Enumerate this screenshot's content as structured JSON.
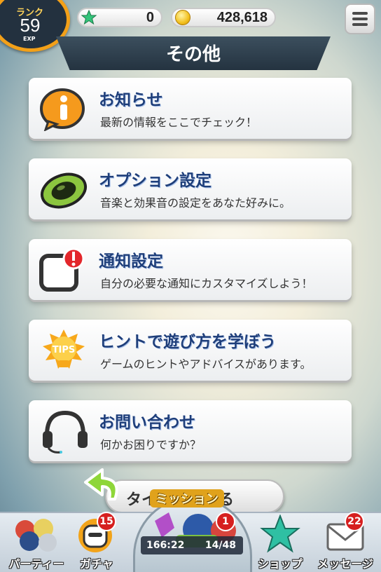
{
  "header": {
    "rank_label": "ランク",
    "rank_value": "59",
    "exp_label": "EXP",
    "stars": "0",
    "coins": "428,618",
    "star_icon": "green-star-icon",
    "coin_icon": "gold-coin-icon"
  },
  "page_title": "その他",
  "menu": [
    {
      "title": "お知らせ",
      "subtitle": "最新の情報をここでチェック！",
      "icon": "info-icon"
    },
    {
      "title": "オプション設定",
      "subtitle": "音楽と効果音の設定をあなた好みに。",
      "icon": "speaker-icon"
    },
    {
      "title": "通知設定",
      "subtitle": "自分の必要な通知にカスタマイズしよう！",
      "icon": "notification-icon"
    },
    {
      "title": "ヒントで遊び方を学ぼう",
      "subtitle": "ゲームのヒントやアドバイスがあります。",
      "icon": "tips-bulb-icon",
      "icon_text": "TIPS"
    },
    {
      "title": "お問い合わせ",
      "subtitle": "何かお困りですか？",
      "icon": "headset-icon"
    }
  ],
  "return_button": "タイトルに戻る",
  "bottom_nav": {
    "party": "パーティー",
    "gacha": "ガチャ",
    "gacha_badge": "15",
    "mission": "ミッション",
    "mission_badge": "1",
    "stamina_time": "166:22",
    "stamina_count": "14/48",
    "shop": "ショップ",
    "message": "メッセージ",
    "message_badge": "22"
  },
  "colors": {
    "title_text": "#1e3e7a",
    "accent_orange": "#f3a018",
    "badge_red": "#d61f1f"
  }
}
